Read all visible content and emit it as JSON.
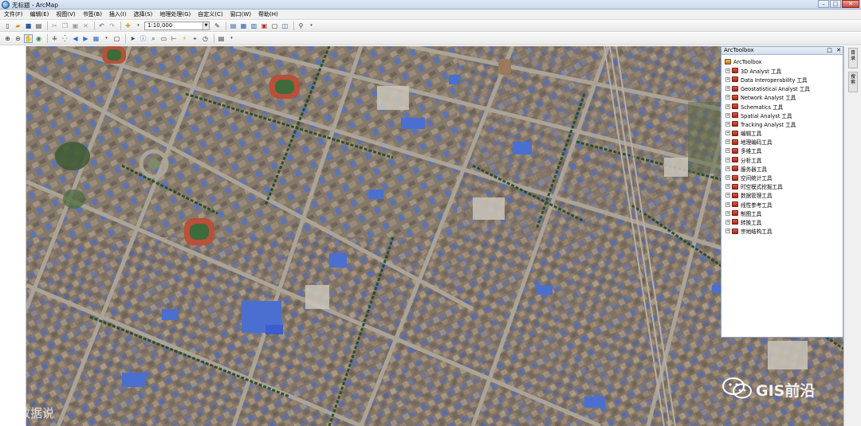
{
  "window": {
    "title": "无标题 - ArcMap"
  },
  "menu": {
    "items": [
      "文件(F)",
      "编辑(E)",
      "视图(V)",
      "书签(B)",
      "插入(I)",
      "选择(S)",
      "地理处理(G)",
      "自定义(C)",
      "窗口(W)",
      "帮助(H)"
    ]
  },
  "toolbar": {
    "scale_value": "1:10,000"
  },
  "toolbox": {
    "title": "ArcToolbox",
    "root_label": "ArcToolbox",
    "items": [
      "3D Analyst 工具",
      "Data Interoperability 工具",
      "Geostatistical Analyst 工具",
      "Network Analyst 工具",
      "Schematics 工具",
      "Spatial Analyst 工具",
      "Tracking Analyst 工具",
      "编辑工具",
      "地理编码工具",
      "多维工具",
      "分析工具",
      "服务器工具",
      "空间统计工具",
      "时空模式挖掘工具",
      "数据管理工具",
      "线性参考工具",
      "制图工具",
      "转换工具",
      "宗地结构工具"
    ]
  },
  "dock": {
    "tab1": "目录",
    "tab2": "搜索"
  },
  "watermark": {
    "left": "大数据说",
    "right": "GIS前沿"
  },
  "colors": {
    "title_bar": "#c9d9ee",
    "map_base": "#7c7468",
    "road": "#a9a39a",
    "tree_row": "#1f4a28",
    "roof_blue": "#4a6fd0",
    "track_red": "#b8503a"
  }
}
